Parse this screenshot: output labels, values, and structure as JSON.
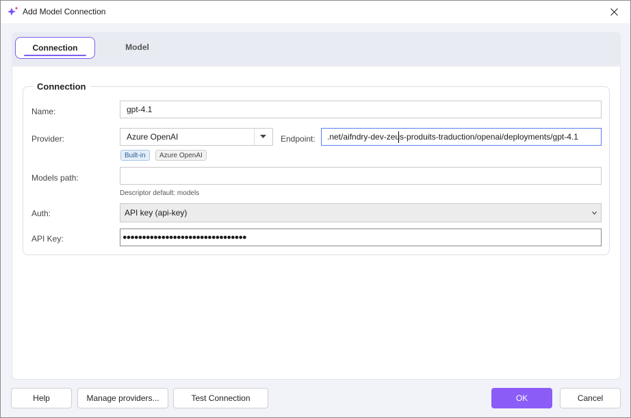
{
  "window": {
    "title": "Add Model Connection",
    "icon": "sparkle-icon",
    "close_icon": "close-icon"
  },
  "tabs": [
    {
      "label": "Connection",
      "active": true
    },
    {
      "label": "Model",
      "active": false
    }
  ],
  "connection": {
    "group_title": "Connection",
    "name": {
      "label": "Name:",
      "value": "gpt-4.1"
    },
    "provider": {
      "label": "Provider:",
      "value": "Azure OpenAI",
      "badges": [
        "Built-in",
        "Azure OpenAI"
      ]
    },
    "endpoint": {
      "label": "Endpoint:",
      "value": ".net/aifndry-dev-zeus-produits-traduction/openai/deployments/gpt-4.1"
    },
    "models_path": {
      "label": "Models path:",
      "value": "",
      "hint": "Descriptor default: models"
    },
    "auth": {
      "label": "Auth:",
      "value": "API key (api-key)"
    },
    "api_key": {
      "label": "API Key:",
      "value": "●●●●●●●●●●●●●●●●●●●●●●●●●●●●●●●●"
    }
  },
  "footer": {
    "help": "Help",
    "manage_providers": "Manage providers...",
    "test_connection": "Test Connection",
    "ok": "OK",
    "cancel": "Cancel"
  },
  "colors": {
    "accent": "#8b5cf6",
    "focus_border": "#5a7ef0"
  }
}
